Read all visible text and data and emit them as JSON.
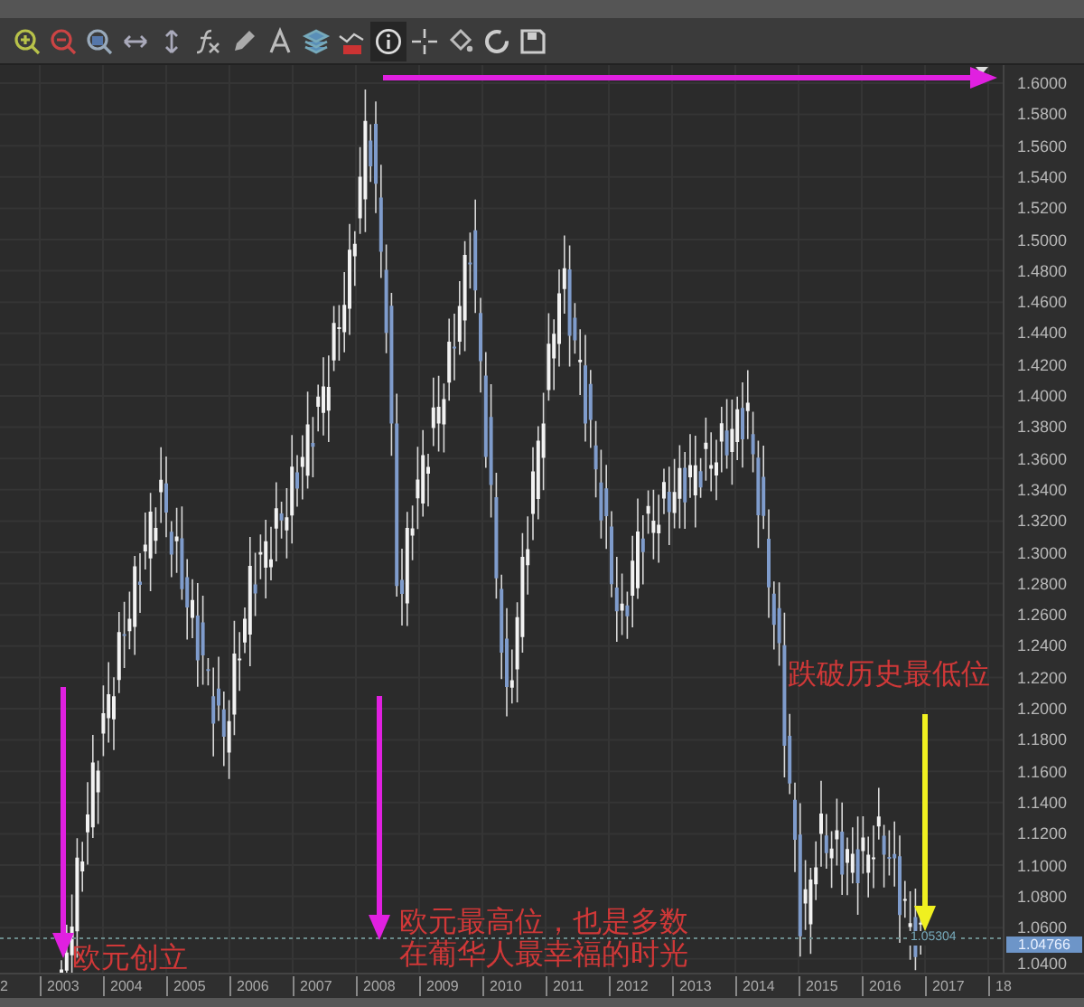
{
  "toolbar": {
    "tools": [
      {
        "kind": "zoomin",
        "selected": false
      },
      {
        "kind": "zoomout",
        "selected": false
      },
      {
        "kind": "zoomfit",
        "selected": false
      },
      {
        "kind": "hstretch",
        "selected": false
      },
      {
        "kind": "vstretch",
        "selected": false
      },
      {
        "kind": "function",
        "selected": false
      },
      {
        "kind": "pencil",
        "selected": false
      },
      {
        "kind": "text",
        "selected": false
      },
      {
        "kind": "layers",
        "selected": false
      },
      {
        "kind": "indicator",
        "selected": false
      },
      {
        "kind": "info",
        "selected": true
      },
      {
        "kind": "crosshair",
        "selected": false
      },
      {
        "kind": "paint",
        "selected": false
      },
      {
        "kind": "refresh",
        "selected": false
      },
      {
        "kind": "save",
        "selected": false
      }
    ]
  },
  "chart": {
    "y_axis_labels": [
      "1.6000",
      "1.5800",
      "1.5600",
      "1.5400",
      "1.5200",
      "1.5000",
      "1.4800",
      "1.4600",
      "1.4400",
      "1.4200",
      "1.4000",
      "1.3800",
      "1.3600",
      "1.3400",
      "1.3200",
      "1.3000",
      "1.2800",
      "1.2600",
      "1.2400",
      "1.2200",
      "1.2000",
      "1.1800",
      "1.1600",
      "1.1400",
      "1.1200",
      "1.1000",
      "1.0800",
      "1.0600",
      "1.0400"
    ],
    "x_axis_labels": [
      "2",
      "2003",
      "2004",
      "2005",
      "2006",
      "2007",
      "2008",
      "2009",
      "2010",
      "2011",
      "2012",
      "2013",
      "2014",
      "2015",
      "2016",
      "2017",
      "18"
    ],
    "reference_line_label": "1.05304",
    "price_tag": "1.04766"
  },
  "annotations": [
    {
      "text": "欧元创立"
    },
    {
      "text": "欧元最高位，也是多数"
    },
    {
      "text": "在葡华人最幸福的时光"
    },
    {
      "text": "跌破历史最低位"
    }
  ]
}
